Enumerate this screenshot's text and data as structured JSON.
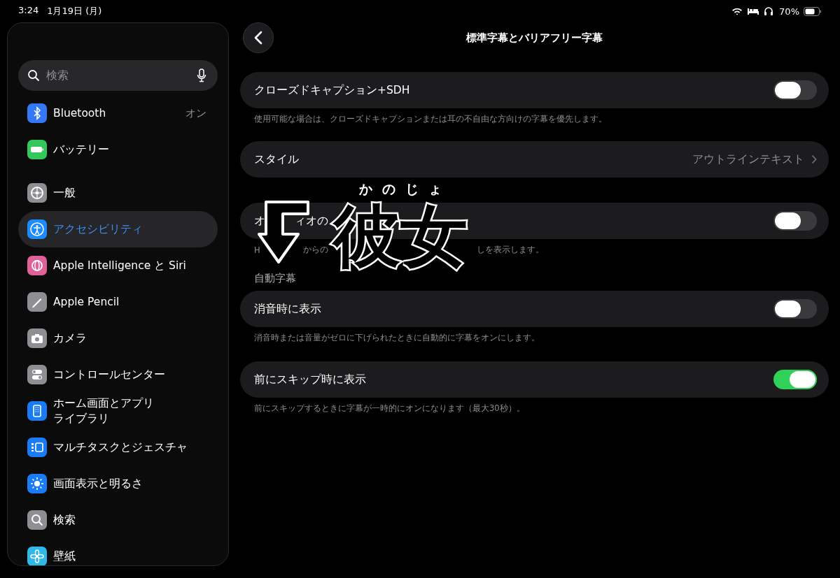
{
  "status_bar": {
    "time": "3:24",
    "date": "1月19日 (月)",
    "battery": "70%"
  },
  "sidebar": {
    "search": {
      "placeholder": "検索"
    },
    "items": [
      {
        "label": "Bluetooth",
        "value": "オン",
        "selected": false,
        "color": "#3478f6"
      },
      {
        "label": "バッテリー",
        "selected": false,
        "color": "#34c759"
      },
      {
        "label": "一般",
        "selected": false,
        "color": "#8e8e93"
      },
      {
        "label": "アクセシビリティ",
        "selected": true,
        "color": "#1a8cff"
      },
      {
        "label": "Apple Intelligence と Siri",
        "selected": false,
        "color": "#e0609a"
      },
      {
        "label": "Apple Pencil",
        "selected": false,
        "color": "#8e8e93"
      },
      {
        "label": "カメラ",
        "selected": false,
        "color": "#8e8e93"
      },
      {
        "label": "コントロールセンター",
        "selected": false,
        "color": "#8e8e93"
      },
      {
        "label": "ホーム画面とアプリライブラリ",
        "selected": false,
        "color": "#1a7cf5"
      },
      {
        "label": "マルチタスクとジェスチャ",
        "selected": false,
        "color": "#1a7cf5"
      },
      {
        "label": "画面表示と明るさ",
        "selected": false,
        "color": "#1a7cf5"
      },
      {
        "label": "検索",
        "selected": false,
        "color": "#8e8e93"
      },
      {
        "label": "壁紙",
        "selected": false,
        "color": "#2fb8e8"
      }
    ]
  },
  "detail": {
    "title": "標準字幕とバリアフリー字幕",
    "sections": [
      {
        "rows": [
          {
            "kind": "toggle",
            "label": "クローズドキャプション+SDH",
            "on": false
          }
        ],
        "footer": "使用可能な場合は、クローズドキャプションまたは耳の不自由な方向けの字幕を優先します。"
      },
      {
        "rows": [
          {
            "kind": "link",
            "label": "スタイル",
            "value": "アウトラインテキスト"
          }
        ]
      },
      {
        "rows": [
          {
            "kind": "toggle",
            "label_parts": [
              "オ",
              "ィオの"
            ],
            "on": false
          }
        ],
        "footer_parts": [
          "H",
          "からの",
          "しを表示します。"
        ]
      },
      {
        "header": "自動字幕",
        "rows": [
          {
            "kind": "toggle",
            "label": "消音時に表示",
            "on": false
          }
        ],
        "footer": "消音時または音量がゼロに下げられたときに自動的に字幕をオンにします。"
      },
      {
        "rows": [
          {
            "kind": "toggle",
            "label": "前にスキップ時に表示",
            "on": true
          }
        ],
        "footer": "前にスキップするときに字幕が一時的にオンになります（最大30秒）。"
      }
    ]
  },
  "overlay": {
    "word": "彼女",
    "reading": "かのじょ"
  }
}
